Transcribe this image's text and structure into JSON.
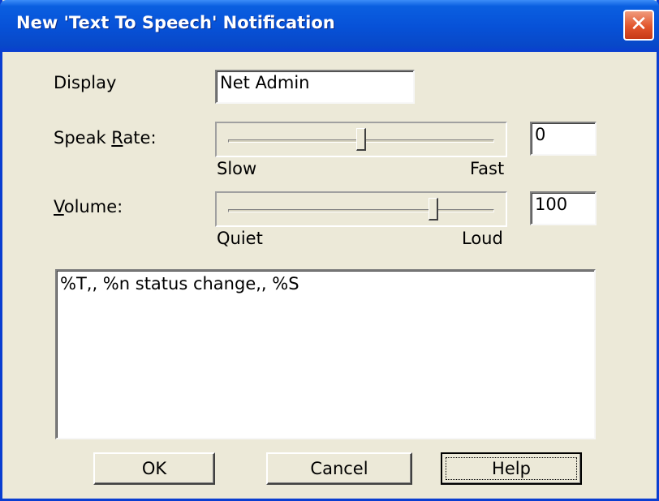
{
  "window": {
    "title": "New 'Text To Speech' Notification",
    "close_glyph": "✕"
  },
  "display": {
    "label": "Display",
    "value": "Net Admin"
  },
  "speak_rate": {
    "label_before": "Speak ",
    "label_accel": "R",
    "label_after": "ate:",
    "min_label": "Slow",
    "max_label": "Fast",
    "value": "0",
    "level": 0.5
  },
  "volume": {
    "label_accel": "V",
    "label_after": "olume:",
    "min_label": "Quiet",
    "max_label": "Loud",
    "value": "100",
    "level": 0.77
  },
  "message": {
    "text": "%T,, %n status change,, %S"
  },
  "buttons": {
    "ok": "OK",
    "cancel": "Cancel",
    "help": "Help"
  },
  "colors": {
    "titlebar": "#0752d8",
    "close": "#e2552c",
    "face": "#ece9d8"
  }
}
